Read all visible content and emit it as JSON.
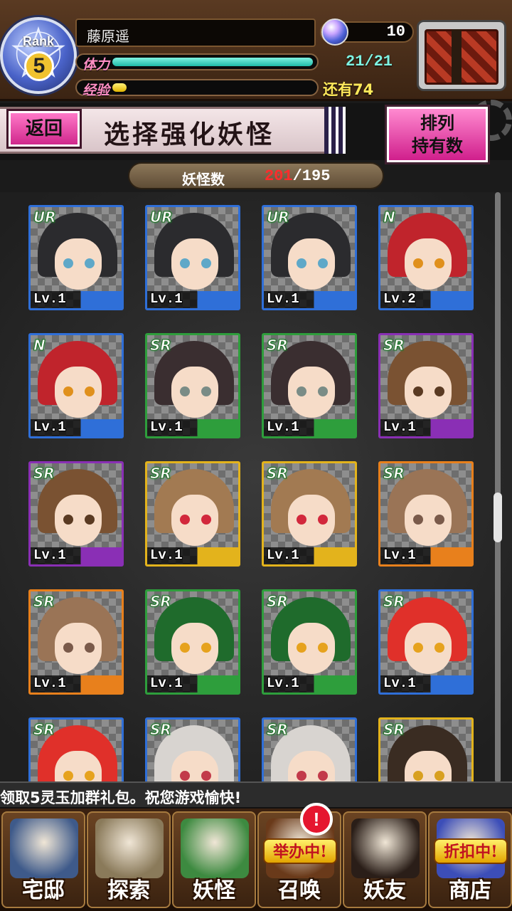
{
  "player": {
    "rank_label": "Rank",
    "rank": "5",
    "name": "藤原遥",
    "hp_label": "体力",
    "hp_text": "21/21",
    "hp_fraction": 1.0,
    "xp_label": "经验",
    "xp_text": "还有74",
    "xp_fraction": 0.07,
    "gems": "10"
  },
  "header": {
    "back_label": "返回",
    "title": "选择强化妖怪",
    "sort_line1": "排列",
    "sort_line2": "持有数"
  },
  "count": {
    "label": "妖怪数",
    "current": "201",
    "max": "/195"
  },
  "cards": [
    {
      "rarity": "UR",
      "level": "Lv.1",
      "frame": "#2f6fd8",
      "hair": "#2b2b2e",
      "eyes": "#5fa8c8"
    },
    {
      "rarity": "UR",
      "level": "Lv.1",
      "frame": "#2f6fd8",
      "hair": "#2b2b2e",
      "eyes": "#5fa8c8"
    },
    {
      "rarity": "UR",
      "level": "Lv.1",
      "frame": "#2f6fd8",
      "hair": "#2b2b2e",
      "eyes": "#5fa8c8"
    },
    {
      "rarity": "N",
      "level": "Lv.2",
      "frame": "#2f6fd8",
      "hair": "#c0242c",
      "eyes": "#e0901c"
    },
    {
      "rarity": "N",
      "level": "Lv.1",
      "frame": "#2f6fd8",
      "hair": "#c0242c",
      "eyes": "#e0901c"
    },
    {
      "rarity": "SR",
      "level": "Lv.1",
      "frame": "#2e9e3c",
      "hair": "#3a2e30",
      "eyes": "#7a8c86"
    },
    {
      "rarity": "SR",
      "level": "Lv.1",
      "frame": "#2e9e3c",
      "hair": "#3a2e30",
      "eyes": "#7a8c86"
    },
    {
      "rarity": "SR",
      "level": "Lv.1",
      "frame": "#8a2fb5",
      "hair": "#7a5232",
      "eyes": "#5a3a22"
    },
    {
      "rarity": "SR",
      "level": "Lv.1",
      "frame": "#8a2fb5",
      "hair": "#7a5232",
      "eyes": "#5a3a22"
    },
    {
      "rarity": "SR",
      "level": "Lv.1",
      "frame": "#e3b31c",
      "hair": "#a27a52",
      "eyes": "#d2283c"
    },
    {
      "rarity": "SR",
      "level": "Lv.1",
      "frame": "#e3b31c",
      "hair": "#a27a52",
      "eyes": "#d2283c"
    },
    {
      "rarity": "SR",
      "level": "Lv.1",
      "frame": "#e8801c",
      "hair": "#9a7456",
      "eyes": "#7a5a4a"
    },
    {
      "rarity": "SR",
      "level": "Lv.1",
      "frame": "#e8801c",
      "hair": "#9a7456",
      "eyes": "#7a5a4a"
    },
    {
      "rarity": "SR",
      "level": "Lv.1",
      "frame": "#2e9e3c",
      "hair": "#1f6b2c",
      "eyes": "#e6a21e"
    },
    {
      "rarity": "SR",
      "level": "Lv.1",
      "frame": "#2e9e3c",
      "hair": "#1f6b2c",
      "eyes": "#e6a21e"
    },
    {
      "rarity": "SR",
      "level": "Lv.1",
      "frame": "#2f6fd8",
      "hair": "#e0302a",
      "eyes": "#e6a21e"
    },
    {
      "rarity": "SR",
      "level": "",
      "frame": "#2f6fd8",
      "hair": "#e0302a",
      "eyes": "#e6a21e"
    },
    {
      "rarity": "SR",
      "level": "",
      "frame": "#2f6fd8",
      "hair": "#d8d4d0",
      "eyes": "#c23a4a"
    },
    {
      "rarity": "SR",
      "level": "",
      "frame": "#2f6fd8",
      "hair": "#d8d4d0",
      "eyes": "#c23a4a"
    },
    {
      "rarity": "SR",
      "level": "",
      "frame": "#e3b31c",
      "hair": "#3a2c22",
      "eyes": "#d8a020"
    }
  ],
  "ticker": "领取5灵玉加群礼包。祝您游戏愉快!",
  "nav": [
    {
      "label": "宅邸",
      "icon": "mansion-icon",
      "color": "#3e5a8a"
    },
    {
      "label": "探索",
      "icon": "magnifier-map-icon",
      "color": "#8a7a5a"
    },
    {
      "label": "妖怪",
      "icon": "scroll-icon",
      "color": "#3d8a40"
    },
    {
      "label": "召唤",
      "icon": "summon-icon",
      "color": "#6a3a1a",
      "badge": "举办中!",
      "notice": "!"
    },
    {
      "label": "妖友",
      "icon": "catgirl-icon",
      "color": "#2a1e18"
    },
    {
      "label": "商店",
      "icon": "crystal-ball-icon",
      "color": "#3c4eb8",
      "badge": "折扣中!"
    }
  ],
  "colors": {
    "accent_pink": "#e0308f",
    "hp_green": "#1fbba8",
    "xp_yellow": "#e0b400",
    "count_red": "#ff2c2c"
  }
}
